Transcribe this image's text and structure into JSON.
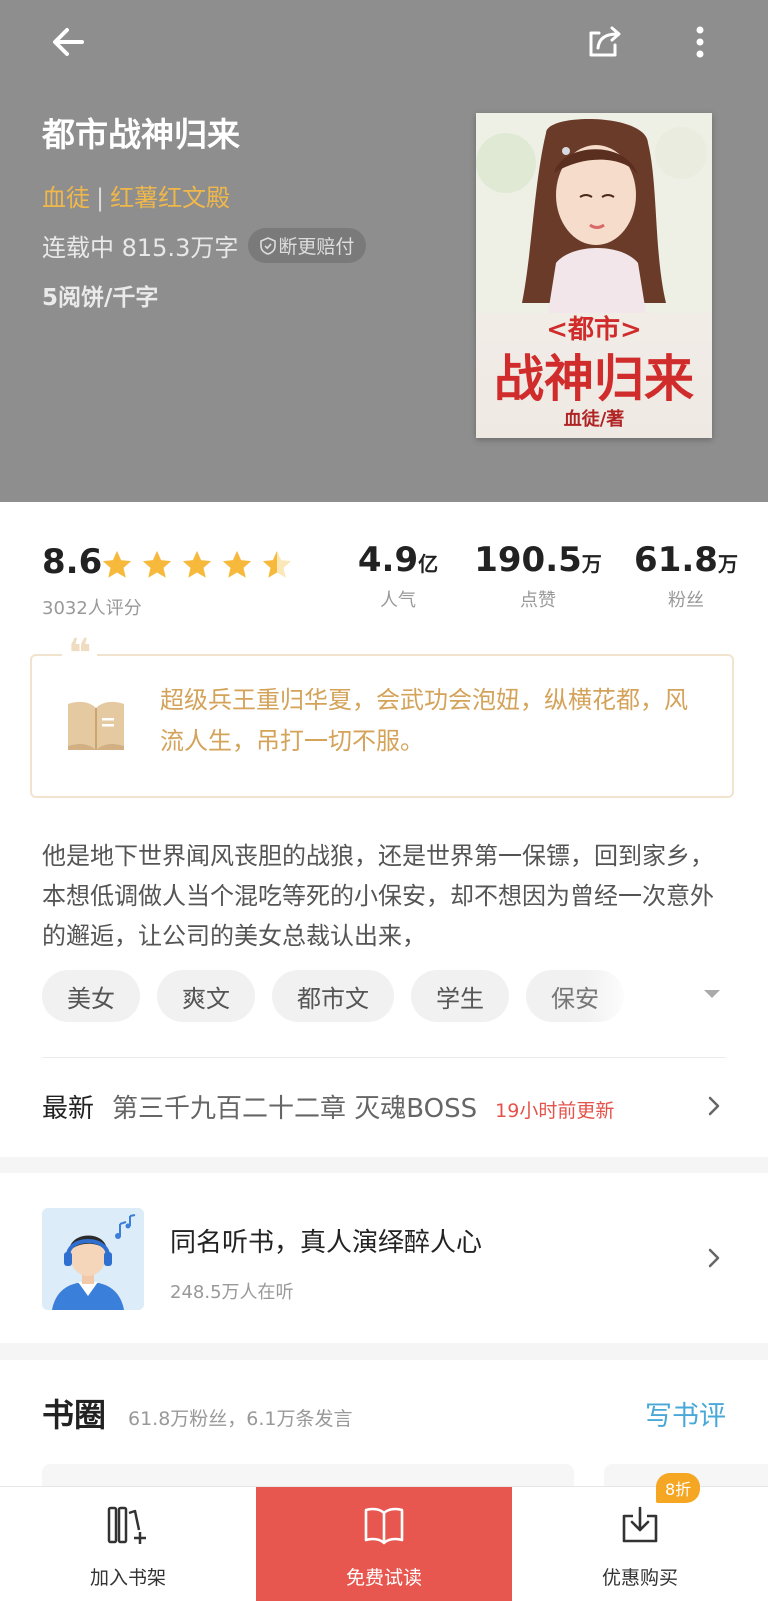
{
  "header": {
    "title": "都市战神归来",
    "author": "血徒",
    "separator": "|",
    "publisher": "红薯红文殿",
    "status": "连载中 815.3万字",
    "badge": "断更赔付",
    "price": "5阅饼/千字"
  },
  "cover": {
    "line1": "<都市>",
    "line2": "战神归来",
    "line3": "血徒/著"
  },
  "rating": {
    "score": "8.6",
    "stars_value": 4.5,
    "count_label": "3032人评分"
  },
  "stats": [
    {
      "value": "4.9",
      "unit": "亿",
      "label": "人气"
    },
    {
      "value": "190.5",
      "unit": "万",
      "label": "点赞"
    },
    {
      "value": "61.8",
      "unit": "万",
      "label": "粉丝"
    }
  ],
  "quote": {
    "mark": "❝",
    "text": "超级兵王重归华夏，会武功会泡妞，纵横花都，风流人生，吊打一切不服。"
  },
  "description": "他是地下世界闻风丧胆的战狼，还是世界第一保镖，回到家乡，本想低调做人当个混吃等死的小保安，却不想因为曾经一次意外的邂逅，让公司的美女总裁认出来，",
  "tags": [
    "美女",
    "爽文",
    "都市文",
    "学生",
    "保安"
  ],
  "latest": {
    "label": "最新",
    "chapter": "第三千九百二十二章  灭魂BOSS",
    "updated": "19小时前更新"
  },
  "audio": {
    "title": "同名听书，真人演绎醉人心",
    "listeners": "248.5万人在听"
  },
  "circle": {
    "title": "书圈",
    "summary": "61.8万粉丝，6.1万条发言",
    "write_review": "写书评"
  },
  "bottom": {
    "shelf": "加入书架",
    "free_read": "免费试读",
    "buy": "优惠购买",
    "discount": "8折"
  },
  "colors": {
    "header_bg": "#8e8e8e",
    "accent_gold": "#f0b84a",
    "accent_red": "#e8574f",
    "link_blue": "#4aa8d8",
    "star": "#f6b93b"
  }
}
